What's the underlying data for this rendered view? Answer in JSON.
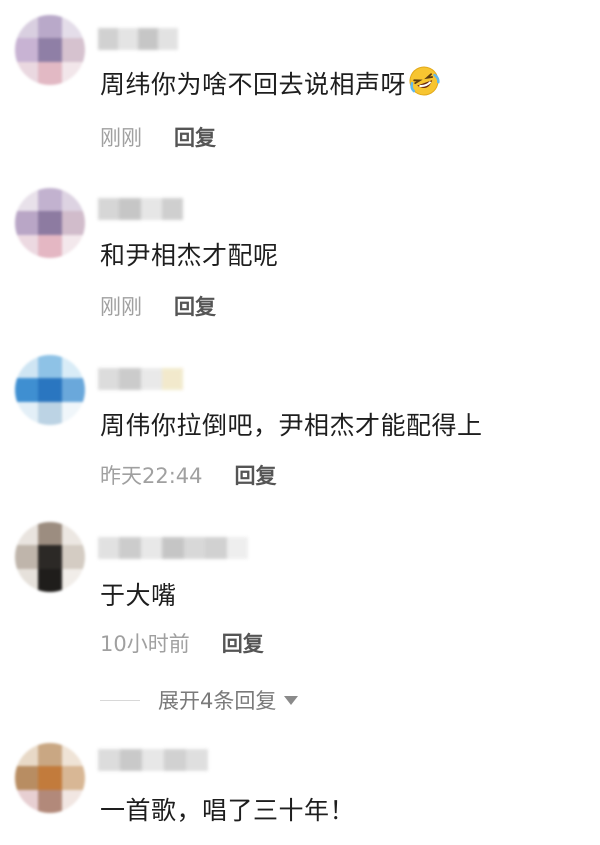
{
  "comments": [
    {
      "text": "周纬你为啥不回去说相声呀",
      "emoji": "rolling-on-floor-laughing-emoji",
      "time": "刚刚",
      "reply_label": "回复"
    },
    {
      "text": "和尹相杰才配呢",
      "time": "刚刚",
      "reply_label": "回复"
    },
    {
      "text": "周伟你拉倒吧，尹相杰才能配得上",
      "time": "昨天22:44",
      "reply_label": "回复"
    },
    {
      "text": "于大嘴",
      "time": "10小时前",
      "reply_label": "回复"
    },
    {
      "text": "一首歌，唱了三十年！"
    }
  ],
  "expand": {
    "label": "展开4条回复"
  },
  "colors": {
    "text": "#1e1e1e",
    "time": "#a0a0a0",
    "reply": "#555555",
    "expand": "#7a7a7a"
  }
}
